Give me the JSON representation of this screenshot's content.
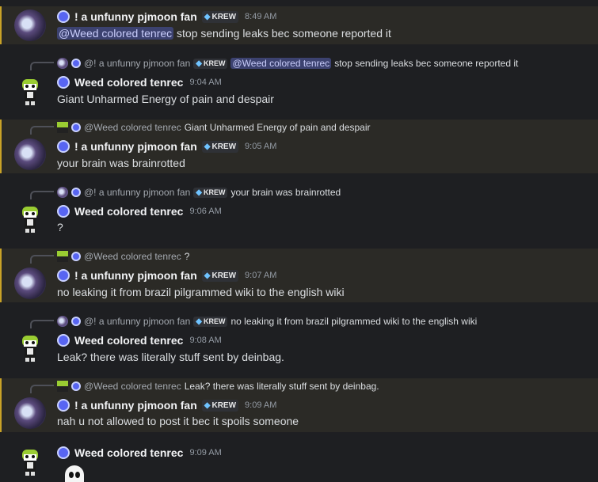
{
  "messages": [
    {
      "author": "! a unfunny pjmoon fan",
      "badge": "KREW",
      "time": "8:49 AM",
      "mention": "@Weed colored tenrec",
      "text": "stop sending leaks bec someone reported it"
    },
    {
      "reply_author": "@! a unfunny pjmoon fan",
      "reply_badge": "KREW",
      "reply_mention": "@Weed colored tenrec",
      "reply_text": "stop sending leaks bec someone reported it",
      "author": "Weed colored tenrec",
      "time": "9:04 AM",
      "text": "Giant Unharmed Energy  of pain and despair"
    },
    {
      "reply_author": "@Weed colored tenrec",
      "reply_text": "Giant Unharmed Energy  of pain and despair",
      "author": "! a unfunny pjmoon fan",
      "badge": "KREW",
      "time": "9:05 AM",
      "text": "your brain was brainrotted"
    },
    {
      "reply_author": "@! a unfunny pjmoon fan",
      "reply_badge": "KREW",
      "reply_text": "your brain was brainrotted",
      "author": "Weed colored tenrec",
      "time": "9:06 AM",
      "text": "?"
    },
    {
      "reply_author": "@Weed colored tenrec",
      "reply_text": "?",
      "author": "! a unfunny pjmoon fan",
      "badge": "KREW",
      "time": "9:07 AM",
      "text": "no leaking it from brazil pilgrammed wiki to the english wiki"
    },
    {
      "reply_author": "@! a unfunny pjmoon fan",
      "reply_badge": "KREW",
      "reply_text": "no leaking it from brazil pilgrammed wiki to the english wiki",
      "author": "Weed colored tenrec",
      "time": "9:08 AM",
      "text": "Leak? there was literally  stuff  sent by deinbag."
    },
    {
      "reply_author": "@Weed colored tenrec",
      "reply_text": "Leak? there was literally  stuff  sent by deinbag.",
      "author": "! a unfunny pjmoon fan",
      "badge": "KREW",
      "time": "9:09 AM",
      "text": "nah u not allowed to post it bec it spoils someone"
    },
    {
      "author": "Weed colored tenrec",
      "time": "9:09 AM"
    }
  ]
}
